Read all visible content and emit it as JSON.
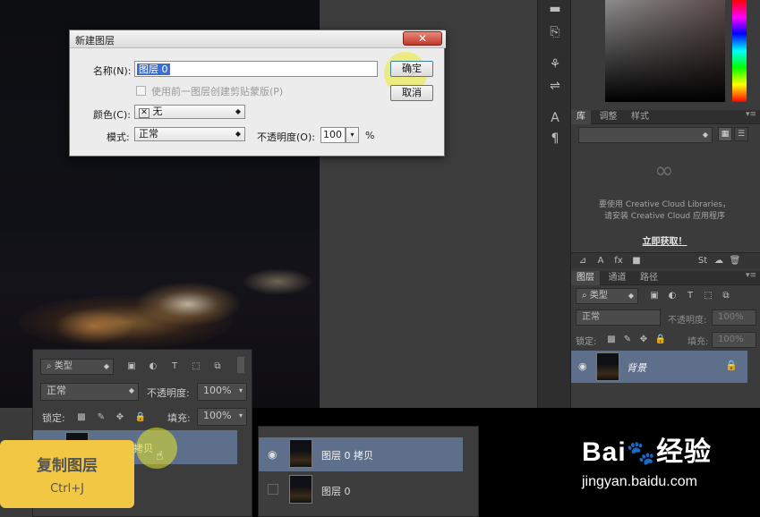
{
  "dialog": {
    "title": "新建图层",
    "name_label": "名称(N):",
    "name_value": "图层 0",
    "clip_checkbox_label": "使用前一图层创建剪贴蒙版(P)",
    "color_label": "颜色(C):",
    "color_value": "无",
    "mode_label": "模式:",
    "mode_value": "正常",
    "opacity_label": "不透明度(O):",
    "opacity_value": "100",
    "percent": "%",
    "ok_label": "确定",
    "cancel_label": "取消"
  },
  "library_panel": {
    "tabs": [
      "库",
      "调整",
      "样式"
    ],
    "message_line1": "要使用 Creative Cloud Libraries，",
    "message_line2": "请安装 Creative Cloud 应用程序",
    "link": "立即获取！"
  },
  "layers_panel_right": {
    "tabs": [
      "图层",
      "通道",
      "路径"
    ],
    "filter_kind": "类型",
    "blend_mode": "正常",
    "opacity_label": "不透明度:",
    "opacity_value": "100%",
    "lock_label": "锁定:",
    "fill_label": "填充:",
    "fill_value": "100%",
    "layer_name": "背景"
  },
  "layers_panel_left": {
    "filter_kind": "类型",
    "blend_mode": "正常",
    "opacity_label": "不透明度:",
    "opacity_value": "100%",
    "lock_label": "锁定:",
    "fill_label": "填充:",
    "fill_value": "100%",
    "layer_name_partial": "拷贝"
  },
  "layers_list_mid": {
    "layers": [
      {
        "name": "图层 0 拷贝",
        "selected": true
      },
      {
        "name": "图层 0",
        "selected": false
      }
    ]
  },
  "tooltip": {
    "title": "复制图层",
    "shortcut": "Ctrl+J"
  },
  "watermark": {
    "url": "jingyan.baidu.com"
  },
  "colors": {
    "tooltip_bg": "#f2c744",
    "selection_blue": "#5e6f8c",
    "dialog_bg": "#ececec",
    "panel_bg": "#3b3b3b"
  }
}
